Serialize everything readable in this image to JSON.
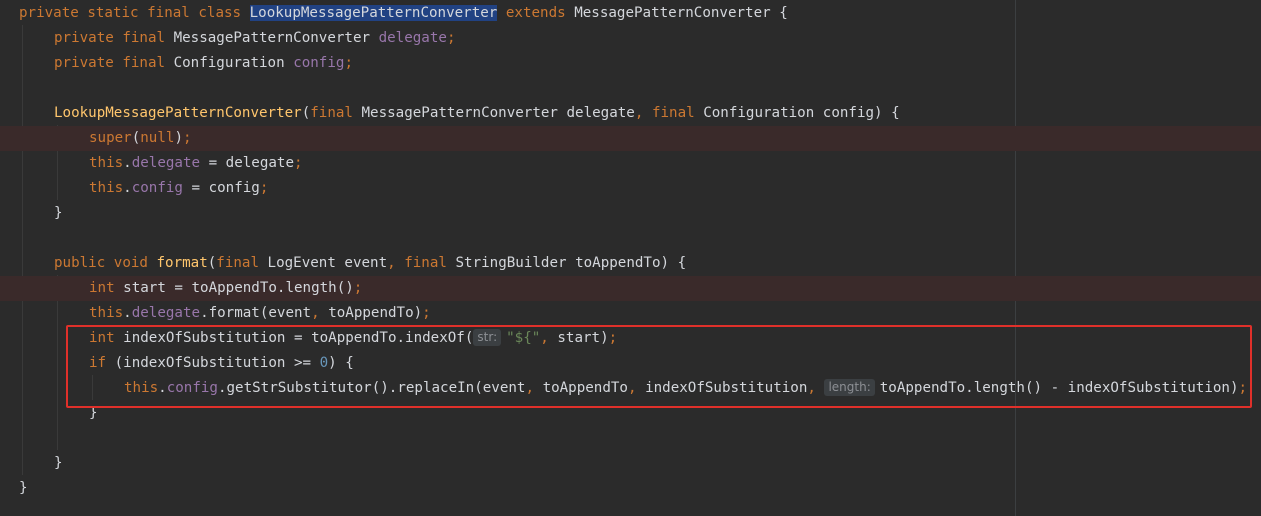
{
  "editor": {
    "language": "Java",
    "colors": {
      "background": "#2b2b2b",
      "keyword": "#cc7832",
      "field": "#9876aa",
      "method": "#ffc66d",
      "number": "#6897bb",
      "string": "#6a8759",
      "selection": "#214283",
      "highlight_box": "#e0302a"
    },
    "lines": [
      {
        "tokens": [
          {
            "t": "kw",
            "v": "private static final class "
          },
          {
            "t": "sel",
            "v": "LookupMessagePatternConverter"
          },
          {
            "t": "kw",
            "v": " extends "
          },
          {
            "t": "plain",
            "v": "MessagePatternConverter {"
          }
        ]
      },
      {
        "tokens": [
          {
            "t": "kw",
            "v": "private final "
          },
          {
            "t": "plain",
            "v": "MessagePatternConverter "
          },
          {
            "t": "fld",
            "v": "delegate"
          },
          {
            "t": "kw",
            "v": ";"
          }
        ]
      },
      {
        "tokens": [
          {
            "t": "kw",
            "v": "private final "
          },
          {
            "t": "plain",
            "v": "Configuration "
          },
          {
            "t": "fld",
            "v": "config"
          },
          {
            "t": "kw",
            "v": ";"
          }
        ]
      },
      {
        "tokens": []
      },
      {
        "tokens": [
          {
            "t": "mth",
            "v": "LookupMessagePatternConverter"
          },
          {
            "t": "plain",
            "v": "("
          },
          {
            "t": "kw",
            "v": "final "
          },
          {
            "t": "plain",
            "v": "MessagePatternConverter delegate"
          },
          {
            "t": "kw",
            "v": ", final "
          },
          {
            "t": "plain",
            "v": "Configuration config) {"
          }
        ]
      },
      {
        "breakpoint": true,
        "tokens": [
          {
            "t": "kw",
            "v": "super"
          },
          {
            "t": "plain",
            "v": "("
          },
          {
            "t": "kw",
            "v": "null"
          },
          {
            "t": "plain",
            "v": ")"
          },
          {
            "t": "kw",
            "v": ";"
          }
        ]
      },
      {
        "tokens": [
          {
            "t": "kw",
            "v": "this"
          },
          {
            "t": "plain",
            "v": "."
          },
          {
            "t": "fld",
            "v": "delegate"
          },
          {
            "t": "plain",
            "v": " = delegate"
          },
          {
            "t": "kw",
            "v": ";"
          }
        ]
      },
      {
        "tokens": [
          {
            "t": "kw",
            "v": "this"
          },
          {
            "t": "plain",
            "v": "."
          },
          {
            "t": "fld",
            "v": "config"
          },
          {
            "t": "plain",
            "v": " = config"
          },
          {
            "t": "kw",
            "v": ";"
          }
        ]
      },
      {
        "tokens": [
          {
            "t": "plain",
            "v": "}"
          }
        ]
      },
      {
        "tokens": []
      },
      {
        "tokens": [
          {
            "t": "kw",
            "v": "public void "
          },
          {
            "t": "mth",
            "v": "format"
          },
          {
            "t": "plain",
            "v": "("
          },
          {
            "t": "kw",
            "v": "final "
          },
          {
            "t": "plain",
            "v": "LogEvent event"
          },
          {
            "t": "kw",
            "v": ", final "
          },
          {
            "t": "plain",
            "v": "StringBuilder toAppendTo) {"
          }
        ]
      },
      {
        "breakpoint": true,
        "tokens": [
          {
            "t": "kw",
            "v": "int "
          },
          {
            "t": "plain",
            "v": "start = toAppendTo.length()"
          },
          {
            "t": "kw",
            "v": ";"
          }
        ]
      },
      {
        "tokens": [
          {
            "t": "kw",
            "v": "this"
          },
          {
            "t": "plain",
            "v": "."
          },
          {
            "t": "fld",
            "v": "delegate"
          },
          {
            "t": "plain",
            "v": ".format(event"
          },
          {
            "t": "kw",
            "v": ", "
          },
          {
            "t": "plain",
            "v": "toAppendTo)"
          },
          {
            "t": "kw",
            "v": ";"
          }
        ]
      },
      {
        "tokens": [
          {
            "t": "kw",
            "v": "int "
          },
          {
            "t": "plain",
            "v": "indexOfSubstitution = toAppendTo.indexOf("
          },
          {
            "t": "hint",
            "v": "str:"
          },
          {
            "t": "str",
            "v": "\"${\""
          },
          {
            "t": "kw",
            "v": ", "
          },
          {
            "t": "plain",
            "v": "start)"
          },
          {
            "t": "kw",
            "v": ";"
          }
        ]
      },
      {
        "tokens": [
          {
            "t": "kw",
            "v": "if "
          },
          {
            "t": "plain",
            "v": "(indexOfSubstitution >= "
          },
          {
            "t": "num",
            "v": "0"
          },
          {
            "t": "plain",
            "v": ") {"
          }
        ]
      },
      {
        "tokens": [
          {
            "t": "kw",
            "v": "this"
          },
          {
            "t": "plain",
            "v": "."
          },
          {
            "t": "fld",
            "v": "config"
          },
          {
            "t": "plain",
            "v": ".getStrSubstitutor().replaceIn(event"
          },
          {
            "t": "kw",
            "v": ", "
          },
          {
            "t": "plain",
            "v": "toAppendTo"
          },
          {
            "t": "kw",
            "v": ", "
          },
          {
            "t": "plain",
            "v": "indexOfSubstitution"
          },
          {
            "t": "kw",
            "v": ", "
          },
          {
            "t": "hint",
            "v": "length:"
          },
          {
            "t": "plain",
            "v": "toAppendTo.length() - indexOfSubstitution)"
          },
          {
            "t": "kw",
            "v": ";"
          }
        ]
      },
      {
        "tokens": [
          {
            "t": "plain",
            "v": "}"
          }
        ]
      },
      {
        "tokens": []
      },
      {
        "tokens": [
          {
            "t": "plain",
            "v": "}"
          }
        ]
      },
      {
        "tokens": [
          {
            "t": "plain",
            "v": "}"
          }
        ]
      }
    ]
  }
}
